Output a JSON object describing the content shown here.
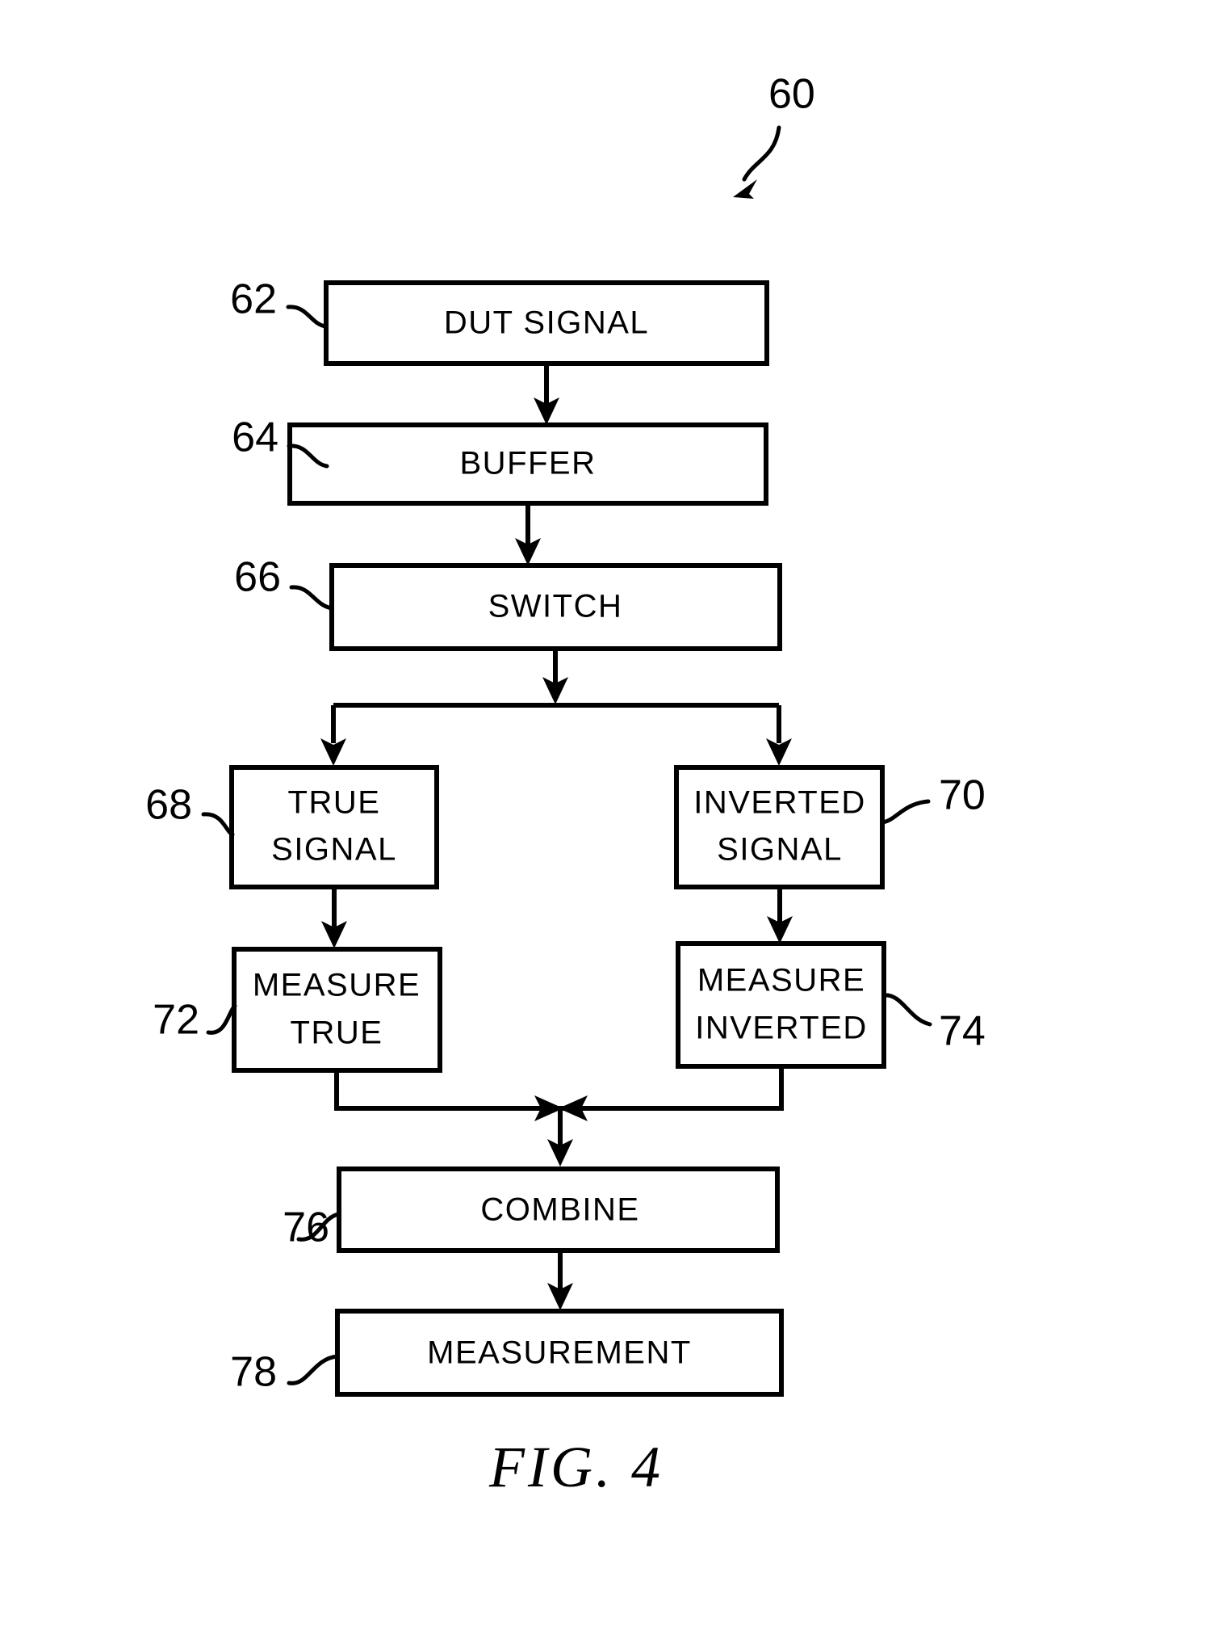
{
  "figure": {
    "caption": "FIG.  4",
    "overall_ref": "60",
    "nodes": [
      {
        "id": "dut_signal",
        "ref": "62",
        "label": "DUT  SIGNAL",
        "lines": [
          "DUT  SIGNAL"
        ]
      },
      {
        "id": "buffer",
        "ref": "64",
        "label": "BUFFER",
        "lines": [
          "BUFFER"
        ]
      },
      {
        "id": "switch",
        "ref": "66",
        "label": "SWITCH",
        "lines": [
          "SWITCH"
        ]
      },
      {
        "id": "true_signal",
        "ref": "68",
        "label": "TRUE SIGNAL",
        "lines": [
          "TRUE",
          "SIGNAL"
        ]
      },
      {
        "id": "inverted_signal",
        "ref": "70",
        "label": "INVERTED SIGNAL",
        "lines": [
          "INVERTED",
          "SIGNAL"
        ]
      },
      {
        "id": "measure_true",
        "ref": "72",
        "label": "MEASURE TRUE",
        "lines": [
          "MEASURE",
          "TRUE"
        ]
      },
      {
        "id": "measure_inverted",
        "ref": "74",
        "label": "MEASURE INVERTED",
        "lines": [
          "MEASURE",
          "INVERTED"
        ]
      },
      {
        "id": "combine",
        "ref": "76",
        "label": "COMBINE",
        "lines": [
          "COMBINE"
        ]
      },
      {
        "id": "measurement",
        "ref": "78",
        "label": "MEASUREMENT",
        "lines": [
          "MEASUREMENT"
        ]
      }
    ],
    "colors": {
      "ink": "#000000",
      "paper": "#ffffff"
    }
  }
}
